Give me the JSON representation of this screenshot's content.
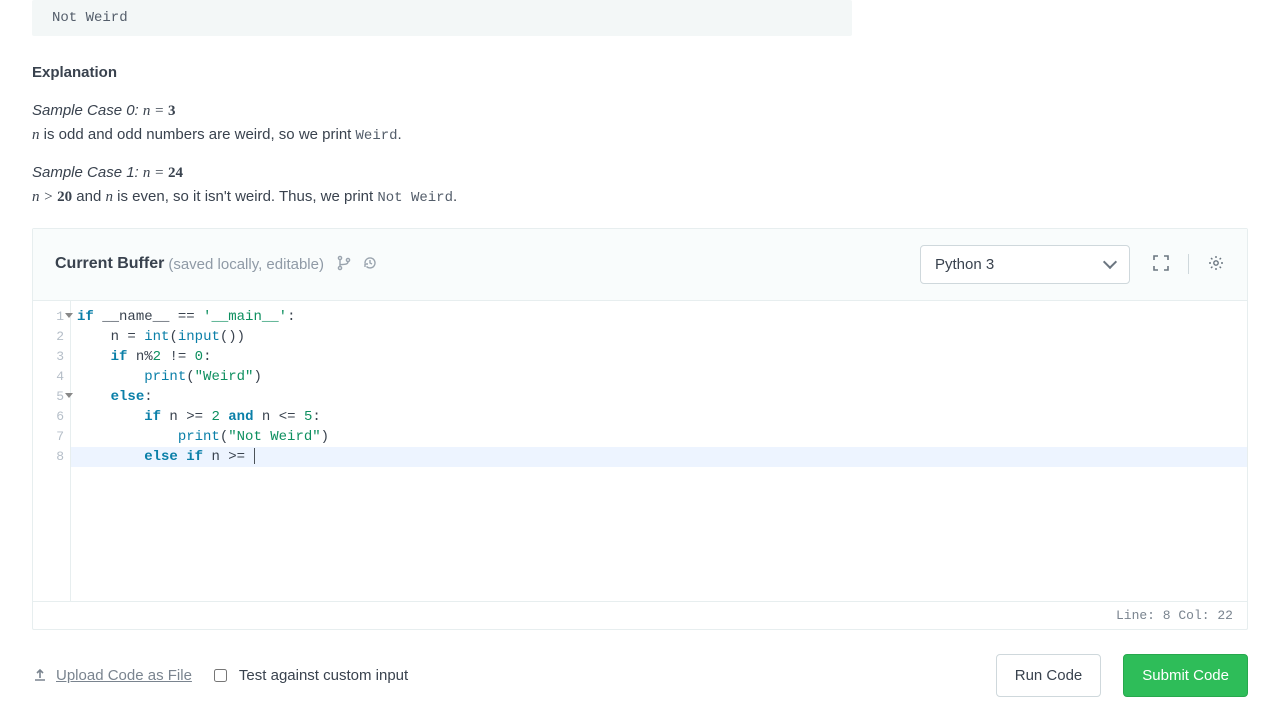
{
  "sample_output": "Not Weird",
  "explanation_title": "Explanation",
  "case0": {
    "label": "Sample Case 0:",
    "eq_var": "n",
    "eq_val": "3",
    "body_pre": " is odd and odd numbers are weird, so we print ",
    "print_val": "Weird",
    "body_post": "."
  },
  "case1": {
    "label": "Sample Case 1:",
    "eq_var": "n",
    "eq_val": "24",
    "cond_lhs": "n",
    "cond_op": " > ",
    "cond_rhs": "20",
    "body_mid1": " and ",
    "body_mid2": " is even, so it isn't weird. Thus, we print ",
    "print_val": "Not Weird",
    "body_post": "."
  },
  "editor": {
    "buffer_title": "Current Buffer",
    "buffer_sub": "(saved locally, editable)",
    "language": "Python 3",
    "status": "Line: 8 Col: 22",
    "lines": [
      {
        "n": "1",
        "fold": true,
        "parts": [
          [
            "kw",
            "if"
          ],
          [
            "plain",
            " __name__ "
          ],
          [
            "plain",
            "=="
          ],
          [
            "plain",
            " "
          ],
          [
            "str",
            "'__main__'"
          ],
          [
            "plain",
            ":"
          ]
        ]
      },
      {
        "n": "2",
        "fold": false,
        "parts": [
          [
            "plain",
            "    n "
          ],
          [
            "plain",
            "="
          ],
          [
            "plain",
            " "
          ],
          [
            "builtin",
            "int"
          ],
          [
            "plain",
            "("
          ],
          [
            "builtin",
            "input"
          ],
          [
            "plain",
            "())"
          ]
        ]
      },
      {
        "n": "3",
        "fold": false,
        "parts": [
          [
            "plain",
            "    "
          ],
          [
            "kw",
            "if"
          ],
          [
            "plain",
            " n"
          ],
          [
            "plain",
            "%"
          ],
          [
            "num",
            "2"
          ],
          [
            "plain",
            " "
          ],
          [
            "plain",
            "!="
          ],
          [
            "plain",
            " "
          ],
          [
            "num",
            "0"
          ],
          [
            "plain",
            ":"
          ]
        ]
      },
      {
        "n": "4",
        "fold": false,
        "parts": [
          [
            "plain",
            "        "
          ],
          [
            "builtin",
            "print"
          ],
          [
            "plain",
            "("
          ],
          [
            "str",
            "\"Weird\""
          ],
          [
            "plain",
            ")"
          ]
        ]
      },
      {
        "n": "5",
        "fold": true,
        "parts": [
          [
            "plain",
            "    "
          ],
          [
            "kw",
            "else"
          ],
          [
            "plain",
            ":"
          ]
        ]
      },
      {
        "n": "6",
        "fold": false,
        "parts": [
          [
            "plain",
            "        "
          ],
          [
            "kw",
            "if"
          ],
          [
            "plain",
            " n "
          ],
          [
            "plain",
            ">="
          ],
          [
            "plain",
            " "
          ],
          [
            "num",
            "2"
          ],
          [
            "plain",
            " "
          ],
          [
            "kw",
            "and"
          ],
          [
            "plain",
            " n "
          ],
          [
            "plain",
            "<="
          ],
          [
            "plain",
            " "
          ],
          [
            "num",
            "5"
          ],
          [
            "plain",
            ":"
          ]
        ]
      },
      {
        "n": "7",
        "fold": false,
        "parts": [
          [
            "plain",
            "            "
          ],
          [
            "builtin",
            "print"
          ],
          [
            "plain",
            "("
          ],
          [
            "str",
            "\"Not Weird\""
          ],
          [
            "plain",
            ")"
          ]
        ]
      },
      {
        "n": "8",
        "fold": false,
        "active": true,
        "cursor": true,
        "parts": [
          [
            "plain",
            "        "
          ],
          [
            "kw",
            "else"
          ],
          [
            "plain",
            " "
          ],
          [
            "kw",
            "if"
          ],
          [
            "plain",
            " n "
          ],
          [
            "plain",
            ">="
          ],
          [
            "plain",
            " "
          ]
        ]
      }
    ]
  },
  "bottom": {
    "upload": "Upload Code as File",
    "test_label": "Test against custom input",
    "run": "Run Code",
    "submit": "Submit Code"
  }
}
